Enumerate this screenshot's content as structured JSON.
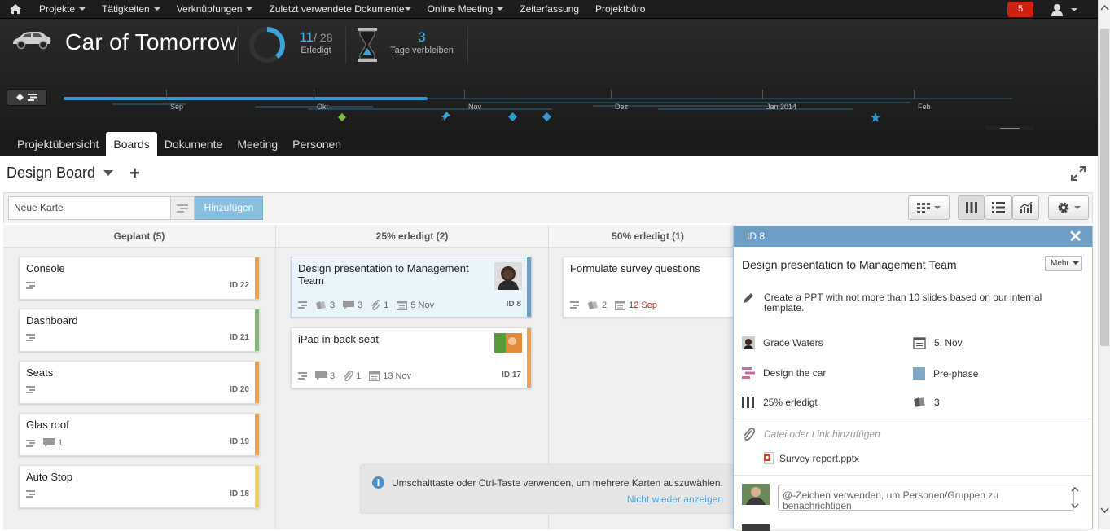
{
  "topnav": {
    "items": [
      "Projekte",
      "Tätigkeiten",
      "Verknüpfungen",
      "Zuletzt verwendete Dokumente",
      "Online Meeting",
      "Zeiterfassung",
      "Projektbüro"
    ],
    "notifications": "5"
  },
  "header": {
    "project_title": "Car of Tomorrow",
    "done_count": "11",
    "done_total": "/ 28",
    "done_label": "Erledigt",
    "done_progress": 0.39,
    "days_count": "3",
    "days_label": "Tage verbleiben"
  },
  "timeline": {
    "months": [
      "Sep",
      "Okt",
      "Nov",
      "Dez",
      "Jan 2014",
      "Feb"
    ]
  },
  "tabs": [
    "Projektübersicht",
    "Boards",
    "Dokumente",
    "Meeting",
    "Personen"
  ],
  "active_tab": "Boards",
  "board": {
    "title": "Design Board",
    "new_card_placeholder": "Neue Karte",
    "add_label": "Hinzufügen"
  },
  "lanes": [
    {
      "title": "Geplant (5)",
      "cards": [
        {
          "title": "Console",
          "id": "ID 22",
          "color": "#f0a04b"
        },
        {
          "title": "Dashboard",
          "id": "ID 21",
          "color": "#7fb77e"
        },
        {
          "title": "Seats",
          "id": "ID 20",
          "color": "#f0a04b"
        },
        {
          "title": "Glas roof",
          "id": "ID 19",
          "color": "#f0a04b",
          "comments": "1"
        },
        {
          "title": "Auto Stop",
          "id": "ID 18",
          "color": "#f5d04c"
        }
      ]
    },
    {
      "title": "25% erledigt (2)",
      "cards": [
        {
          "title": "Design presentation to Management Team",
          "id": "ID 8",
          "color": "#6d9fc4",
          "effort": "3",
          "comments": "3",
          "attachments": "1",
          "due": "5 Nov"
        },
        {
          "title": "iPad in back seat",
          "id": "ID 17",
          "color": "#f0a04b",
          "comments": "3",
          "attachments": "1",
          "due": "13 Nov"
        }
      ]
    },
    {
      "title": "50% erledigt (1)",
      "cards": [
        {
          "title": "Formulate survey questions",
          "effort": "2",
          "due": "12 Sep"
        }
      ]
    }
  ],
  "detail": {
    "id": "ID 8",
    "title": "Design presentation to Management Team",
    "more": "Mehr",
    "description": "Create a PPT with not more than 10 slides based on our internal template.",
    "assignee": "Grace Waters",
    "due": "5. Nov.",
    "board": "Design the car",
    "phase": "Pre-phase",
    "phase_color": "#7fa8c9",
    "progress": "25% erledigt",
    "effort": "3",
    "attach_placeholder": "Datei oder Link hinzufügen",
    "file": "Survey report.pptx",
    "comment_placeholder": "@-Zeichen verwenden, um Personen/Gruppen zu benachrichtigen"
  },
  "tip": {
    "text": "Umschalttaste oder Ctrl-Taste verwenden, um mehrere Karten auszuwählen.",
    "link": "Nicht wieder anzeigen"
  }
}
